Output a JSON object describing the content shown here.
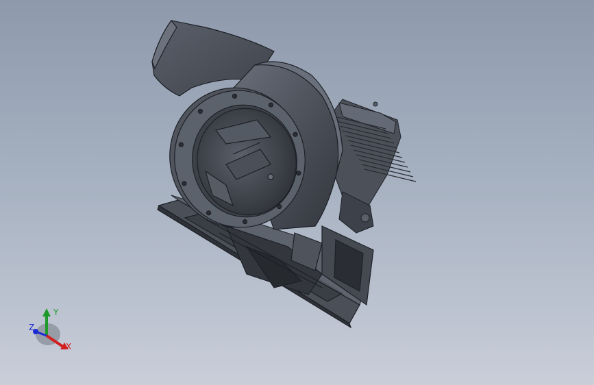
{
  "viewport": {
    "background_top": "#8e9aac",
    "background_bottom": "#c9ced9",
    "model": {
      "shade_dark": "#3b3f47",
      "shade_mid": "#4b5059",
      "shade_light": "#606672",
      "edge": "#1d2026"
    }
  },
  "triad": {
    "x_label": "X",
    "y_label": "Y",
    "z_label": "Z",
    "x_color": "#d11f1f",
    "y_color": "#1d9a2a",
    "z_color": "#1a2ad4"
  }
}
